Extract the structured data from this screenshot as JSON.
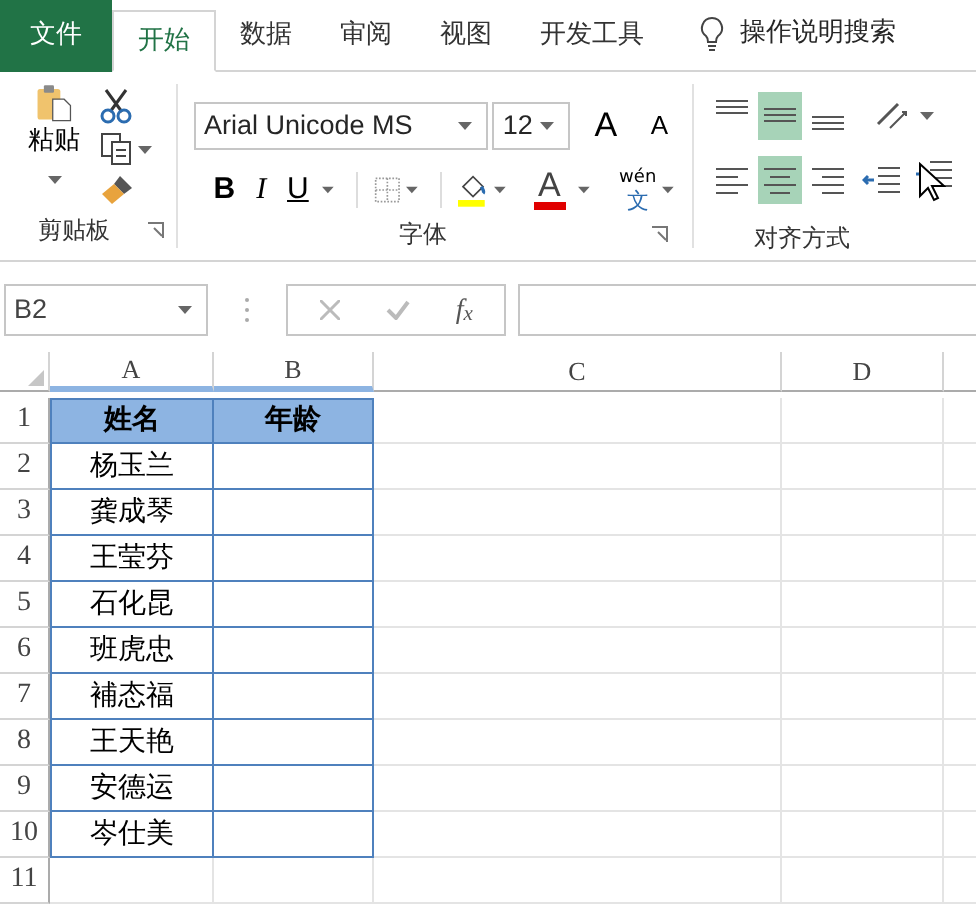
{
  "tabs": [
    {
      "label": "文件",
      "kind": "file",
      "selected": false
    },
    {
      "label": "开始",
      "kind": "tab",
      "selected": true
    },
    {
      "label": "数据",
      "kind": "tab",
      "selected": false
    },
    {
      "label": "审阅",
      "kind": "tab",
      "selected": false
    },
    {
      "label": "视图",
      "kind": "tab",
      "selected": false
    },
    {
      "label": "开发工具",
      "kind": "tab",
      "selected": false
    }
  ],
  "tell_me": "操作说明搜索",
  "ribbon": {
    "clipboard": {
      "paste_label": "粘贴",
      "group_label": "剪贴板"
    },
    "font": {
      "font_name": "Arial Unicode MS",
      "font_size": "12",
      "grow": "A",
      "shrink": "A",
      "bold": "B",
      "italic": "I",
      "underline": "U",
      "font_color": "A",
      "phonetic_top": "wén",
      "phonetic_bottom": "文",
      "group_label": "字体"
    },
    "alignment": {
      "vertical": [
        {
          "kind": "top",
          "selected": false
        },
        {
          "kind": "middle",
          "selected": true
        },
        {
          "kind": "bottom",
          "selected": false
        }
      ],
      "horizontal": [
        {
          "kind": "left",
          "selected": false
        },
        {
          "kind": "center",
          "selected": true
        },
        {
          "kind": "right",
          "selected": false
        }
      ],
      "group_label": "对齐方式"
    }
  },
  "formula_bar": {
    "name_box": "B2",
    "function_label": "f$_{x}$"
  },
  "sheet": {
    "columns": [
      {
        "label": "A",
        "selected": true
      },
      {
        "label": "B",
        "selected": true
      },
      {
        "label": "C",
        "selected": false
      },
      {
        "label": "D",
        "selected": false
      }
    ],
    "rows": [
      {
        "number": "1",
        "kind": "header",
        "cells": [
          "姓名",
          "年龄"
        ]
      },
      {
        "number": "2",
        "kind": "data",
        "cells": [
          "杨玉兰"
        ]
      },
      {
        "number": "3",
        "kind": "data",
        "cells": [
          "龚成琴"
        ]
      },
      {
        "number": "4",
        "kind": "data",
        "cells": [
          "王莹芬"
        ]
      },
      {
        "number": "5",
        "kind": "data",
        "cells": [
          "石化昆"
        ]
      },
      {
        "number": "6",
        "kind": "data",
        "cells": [
          "班虎忠"
        ]
      },
      {
        "number": "7",
        "kind": "data",
        "cells": [
          "補态福"
        ]
      },
      {
        "number": "8",
        "kind": "data",
        "cells": [
          "王天艳"
        ]
      },
      {
        "number": "9",
        "kind": "data",
        "cells": [
          "安德运"
        ]
      },
      {
        "number": "10",
        "kind": "data",
        "cells": [
          "岑仕美"
        ]
      },
      {
        "number": "11",
        "kind": "blank"
      }
    ]
  }
}
